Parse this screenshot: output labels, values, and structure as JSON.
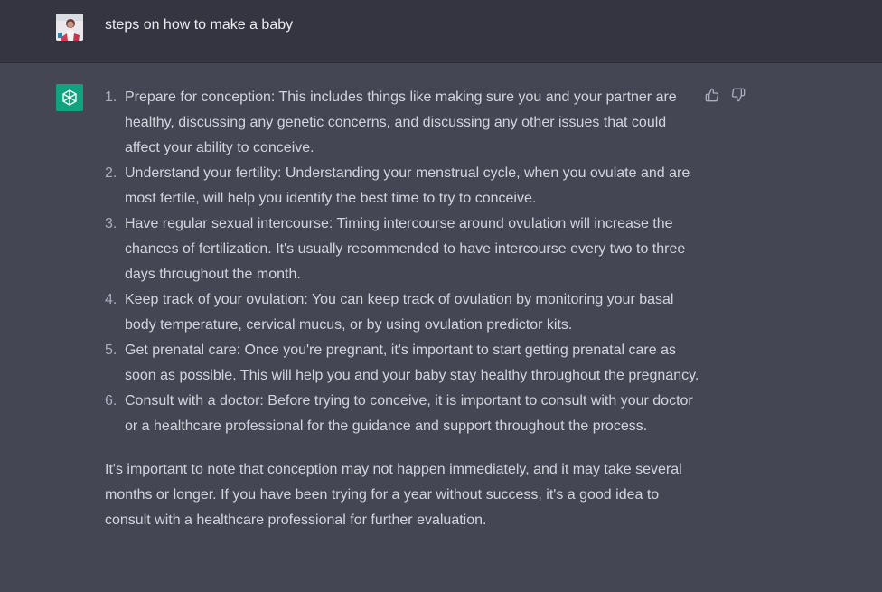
{
  "user_message": {
    "text": "steps on how to make a baby",
    "avatar_icon": "user-avatar-photo"
  },
  "assistant_message": {
    "avatar_icon": "openai-logo-icon",
    "avatar_color": "#10a37f",
    "steps": [
      {
        "num": "1.",
        "text": "Prepare for conception: This includes things like making sure you and your partner are healthy, discussing any genetic concerns, and discussing any other issues that could affect your ability to conceive."
      },
      {
        "num": "2.",
        "text": "Understand your fertility: Understanding your menstrual cycle, when you ovulate and are most fertile, will help you identify the best time to try to conceive."
      },
      {
        "num": "3.",
        "text": "Have regular sexual intercourse: Timing intercourse around ovulation will increase the chances of fertilization. It's usually recommended to have intercourse every two to three days throughout the month."
      },
      {
        "num": "4.",
        "text": "Keep track of your ovulation: You can keep track of ovulation by monitoring your basal body temperature, cervical mucus, or by using ovulation predictor kits."
      },
      {
        "num": "5.",
        "text": "Get prenatal care: Once you're pregnant, it's important to start getting prenatal care as soon as possible. This will help you and your baby stay healthy throughout the pregnancy."
      },
      {
        "num": "6.",
        "text": "Consult with a doctor: Before trying to conceive, it is important to consult with your doctor or a healthcare professional for the guidance and support throughout the process."
      }
    ],
    "closing": "It's important to note that conception may not happen immediately, and it may take several months or longer. If you have been trying for a year without success, it's a good idea to consult with a healthcare professional for further evaluation."
  },
  "feedback": {
    "thumbs_up_icon": "thumbs-up-icon",
    "thumbs_down_icon": "thumbs-down-icon"
  },
  "colors": {
    "user_row_bg": "#343541",
    "assistant_row_bg": "#444654",
    "text": "#d1d5db"
  }
}
